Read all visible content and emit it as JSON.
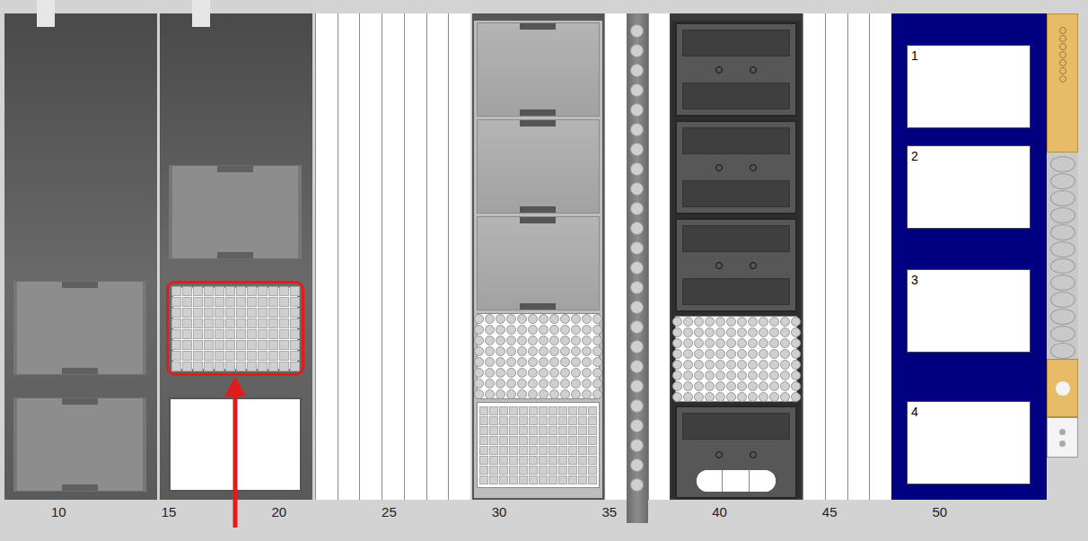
{
  "deck": {
    "segments": [
      {
        "kind": "carrier",
        "tone": "dark",
        "slots": [
          {
            "kind": "lid",
            "selected": false
          },
          {
            "kind": "lid",
            "selected": false
          }
        ]
      },
      {
        "kind": "carrier",
        "tone": "dark",
        "slots": [
          {
            "kind": "lid",
            "selected": false
          },
          {
            "kind": "square-plate",
            "selected": true
          },
          {
            "kind": "blank-plate",
            "selected": false
          }
        ]
      },
      {
        "kind": "tracks",
        "count": 7
      },
      {
        "kind": "carrier",
        "tone": "light",
        "slots": [
          {
            "kind": "lid",
            "selected": false
          },
          {
            "kind": "lid",
            "selected": false
          },
          {
            "kind": "lid",
            "selected": false
          },
          {
            "kind": "round-plate",
            "selected": false
          },
          {
            "kind": "square-plate",
            "selected": false
          }
        ]
      },
      {
        "kind": "tracks",
        "count": 1
      },
      {
        "kind": "tip-strip",
        "tips": 24
      },
      {
        "kind": "tracks",
        "count": 1
      },
      {
        "kind": "carrier",
        "tone": "black",
        "slots": [
          {
            "kind": "box",
            "selected": false
          },
          {
            "kind": "box",
            "selected": false
          },
          {
            "kind": "box",
            "selected": false
          },
          {
            "kind": "round-plate",
            "selected": false
          },
          {
            "kind": "trough",
            "selected": false
          }
        ]
      },
      {
        "kind": "tracks",
        "count": 4
      },
      {
        "kind": "positions",
        "labels": [
          "1",
          "2",
          "3",
          "4"
        ]
      },
      {
        "kind": "side-strip"
      }
    ]
  },
  "axis": {
    "ticks": [
      "10",
      "15",
      "20",
      "25",
      "30",
      "35",
      "40",
      "45",
      "50"
    ]
  },
  "annotation": {
    "arrow": true
  }
}
